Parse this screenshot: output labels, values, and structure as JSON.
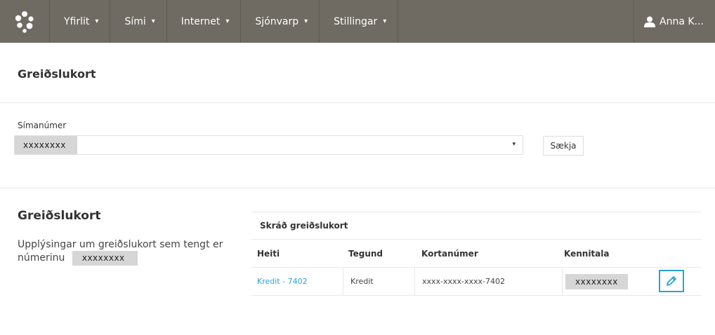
{
  "nav": {
    "items": [
      {
        "label": "Yfirlit",
        "caret": "▾"
      },
      {
        "label": "Sími",
        "caret": "▾"
      },
      {
        "label": "Internet",
        "caret": "▾"
      },
      {
        "label": "Sjónvarp",
        "caret": "▾"
      },
      {
        "label": "Stillingar",
        "caret": "▾"
      }
    ],
    "user_name": "Anna K..."
  },
  "page": {
    "title": "Greiðslukort"
  },
  "phone": {
    "label": "Símanúmer",
    "value": "xxxxxxxx",
    "arrow": "▾",
    "fetch_label": "Sækja"
  },
  "cards": {
    "title": "Greiðslukort",
    "description": "Upplýsingar um greiðslukort sem tengt er númerinu",
    "number_mask": "xxxxxxxx",
    "table": {
      "caption": "Skráð greiðslukort",
      "headers": [
        "Heiti",
        "Tegund",
        "Kortanúmer",
        "Kennitala"
      ],
      "rows": [
        {
          "name": "Kredit - 7402",
          "type": "Kredit",
          "card_number": "xxxx-xxxx-xxxx-7402",
          "kennitala": "xxxxxxxx"
        }
      ]
    }
  },
  "colors": {
    "topbar": "#6f6b62",
    "accent": "#29a3d6",
    "mask": "#d6d6d6"
  }
}
